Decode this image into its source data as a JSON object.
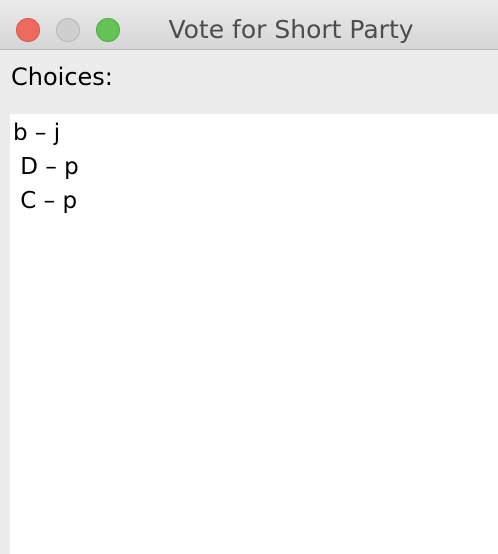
{
  "window": {
    "title": "Vote for Short Party",
    "controls": [
      "close",
      "minimize",
      "zoom"
    ]
  },
  "choices": {
    "label": "Choices:",
    "items": [
      {
        "text": "b – j"
      },
      {
        "text": " D – p"
      },
      {
        "text": " C – p"
      }
    ]
  },
  "colors": {
    "close": "#ed6a5e",
    "minimize": "#cfcfcf",
    "zoom": "#61c454",
    "list_background": "#ffffff",
    "window_background": "#ececec"
  }
}
